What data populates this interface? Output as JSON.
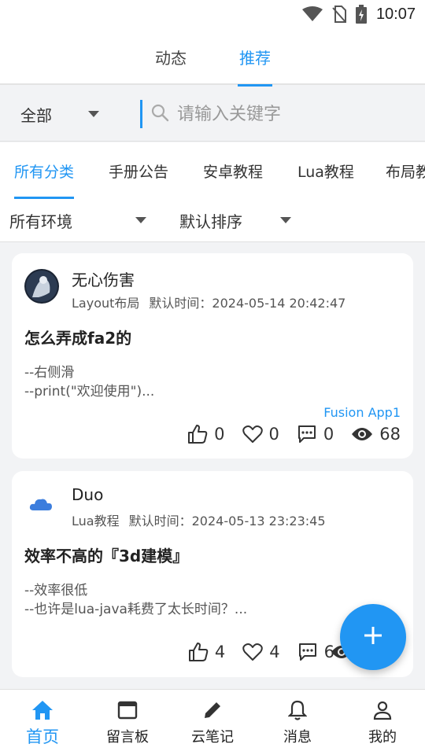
{
  "status_bar": {
    "time": "10:07",
    "icons": [
      "wifi-icon",
      "no-sim-icon",
      "battery-charging-icon"
    ]
  },
  "top_tabs": [
    {
      "label": "动态",
      "active": false
    },
    {
      "label": "推荐",
      "active": true
    }
  ],
  "search": {
    "scope": "全部",
    "placeholder": "请输入关键字",
    "value": ""
  },
  "category_tabs": [
    {
      "label": "所有分类",
      "active": true
    },
    {
      "label": "手册公告",
      "active": false
    },
    {
      "label": "安卓教程",
      "active": false
    },
    {
      "label": "Lua教程",
      "active": false
    },
    {
      "label": "布局教",
      "active": false
    }
  ],
  "filters": {
    "environment": "所有环境",
    "sort": "默认排序"
  },
  "posts": [
    {
      "author": "无心伤害",
      "category": "Layout布局",
      "time": "默认时间：2024-05-14 20:42:47",
      "title": "怎么弄成fa2的",
      "excerpt": [
        "--右侧滑",
        "--print(\"欢迎使用\")..."
      ],
      "tag": "Fusion App1",
      "likes": "0",
      "favorites": "0",
      "comments": "0",
      "views": "68",
      "avatar_icon": "dark-figure-avatar"
    },
    {
      "author": "Duo",
      "category": "Lua教程",
      "time": "默认时间：2024-05-13 23:23:45",
      "title": "效率不高的『3d建模』",
      "excerpt": [
        "--效率很低",
        "--也许是lua-java耗费了太长时间？..."
      ],
      "tag": "",
      "likes": "4",
      "favorites": "4",
      "comments": "6",
      "views": "",
      "avatar_icon": "cloud-avatar"
    }
  ],
  "fab": {
    "icon": "plus-icon"
  },
  "bottom_nav": [
    {
      "label": "首页",
      "icon": "home-icon",
      "active": true
    },
    {
      "label": "留言板",
      "icon": "window-icon",
      "active": false
    },
    {
      "label": "云笔记",
      "icon": "pencil-icon",
      "active": false
    },
    {
      "label": "消息",
      "icon": "bell-icon",
      "active": false
    },
    {
      "label": "我的",
      "icon": "person-icon",
      "active": false
    }
  ],
  "colors": {
    "accent": "#2196f3",
    "background": "#f2f3f5",
    "card": "#ffffff"
  }
}
